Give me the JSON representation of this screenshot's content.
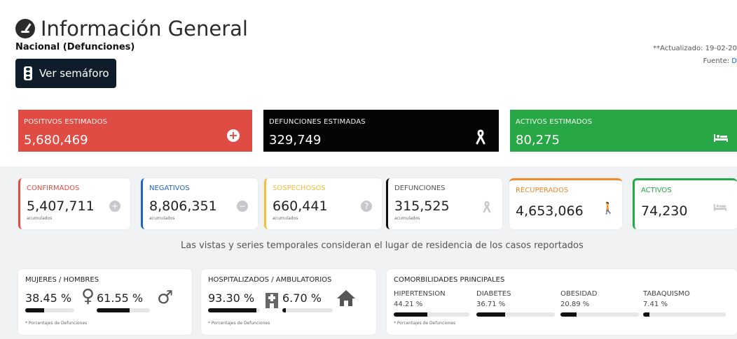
{
  "header": {
    "title": "Información General",
    "subtitle": "Nacional (Defunciones)",
    "semaforo_button": "Ver semáforo",
    "updated": "**Actualizado: 19-02-20",
    "source_label": "Fuente: ",
    "source_link": "D"
  },
  "estimated": [
    {
      "label": "POSITIVOS ESTIMADOS",
      "value": "5,680,469",
      "icon": "plus-circle-icon"
    },
    {
      "label": "DEFUNCIONES ESTIMADAS",
      "value": "329,749",
      "icon": "ribbon-icon"
    },
    {
      "label": "ACTIVOS ESTIMADOS",
      "value": "80,275",
      "icon": "bed-icon"
    }
  ],
  "stats": [
    {
      "label": "CONFIRMADOS",
      "value": "5,407,711",
      "note": "acumulados",
      "icon": "plus-circle-icon"
    },
    {
      "label": "NEGATIVOS",
      "value": "8,806,351",
      "note": "acumulados",
      "icon": "minus-circle-icon"
    },
    {
      "label": "SOSPECHOSOS",
      "value": "660,441",
      "note": "acumulados",
      "icon": "question-circle-icon"
    },
    {
      "label": "DEFUNCIONES",
      "value": "315,525",
      "note": "acumulados",
      "icon": "ribbon-icon"
    },
    {
      "label": "RECUPERADOS",
      "value": "4,653,066",
      "icon": "walking-person-icon"
    },
    {
      "label": "ACTIVOS",
      "value": "74,230",
      "icon": "bed-icon"
    }
  ],
  "notice": "Las vistas y series temporales consideran el lugar de residencia de los casos reportados",
  "gender": {
    "label": "MUJERES / HOMBRES",
    "women_pct": "38.45 %",
    "men_pct": "61.55 %",
    "women_fraction": 0.3845,
    "men_fraction": 0.6155,
    "footnote": "* Porcentajes de Defunciones"
  },
  "hospital": {
    "label": "HOSPITALIZADOS / AMBULATORIOS",
    "hosp_pct": "93.30 %",
    "amb_pct": "6.70 %",
    "hosp_fraction": 0.933,
    "amb_fraction": 0.067,
    "footnote": "* Porcentajes de Defunciones"
  },
  "comorbid": {
    "label": "COMORBILIDADES PRINCIPALES",
    "items": [
      {
        "name": "HIPERTENSION",
        "pct": "44.21 %",
        "fraction": 0.4421
      },
      {
        "name": "DIABETES",
        "pct": "36.71 %",
        "fraction": 0.3671
      },
      {
        "name": "OBESIDAD",
        "pct": "20.89 %",
        "fraction": 0.2089
      },
      {
        "name": "TABAQUISMO",
        "pct": "7.41 %",
        "fraction": 0.0741
      }
    ],
    "footnote": "* Porcentajes de Defunciones"
  },
  "colors": {
    "red": "#e04c43",
    "black": "#050505",
    "green": "#27a745",
    "blue": "#1e63c7",
    "yellow": "#f4be3a",
    "orange": "#f08a2c",
    "navy": "#0f1c2a"
  }
}
